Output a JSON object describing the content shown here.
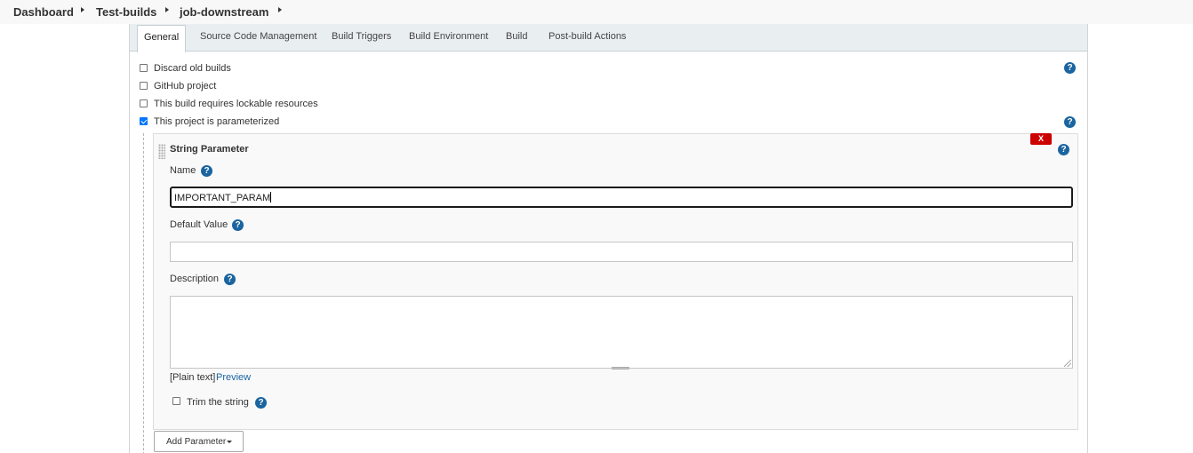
{
  "breadcrumb": {
    "items": [
      "Dashboard",
      "Test-builds",
      "job-downstream"
    ]
  },
  "tabs": [
    "General",
    "Source Code Management",
    "Build Triggers",
    "Build Environment",
    "Build",
    "Post-build Actions"
  ],
  "active_tab": "General",
  "options": [
    {
      "label": "Discard old builds",
      "checked": false
    },
    {
      "label": "GitHub project",
      "checked": false
    },
    {
      "label": "This build requires lockable resources",
      "checked": false
    },
    {
      "label": "This project is parameterized",
      "checked": true
    }
  ],
  "parameter": {
    "title": "String Parameter",
    "delete_label": "X",
    "name_label": "Name",
    "name_value": "IMPORTANT_PARAM",
    "default_label": "Default Value",
    "default_value": "",
    "description_label": "Description",
    "description_value": "",
    "format_label": "[Plain text]",
    "preview_label": "Preview",
    "trim_label": "Trim the string",
    "trim_checked": false
  },
  "add_parameter_label": "Add Parameter",
  "help_glyph": "?",
  "colors": {
    "help_icon": "#1a64a0",
    "delete_button": "#cc0000",
    "checkbox_checked": "#0075ff",
    "tab_bar": "#e9eef1"
  },
  "icons": [
    "caret-right-icon",
    "help-icon",
    "drag-handle-icon",
    "dropdown-caret-icon",
    "resize-grip-icon"
  ]
}
